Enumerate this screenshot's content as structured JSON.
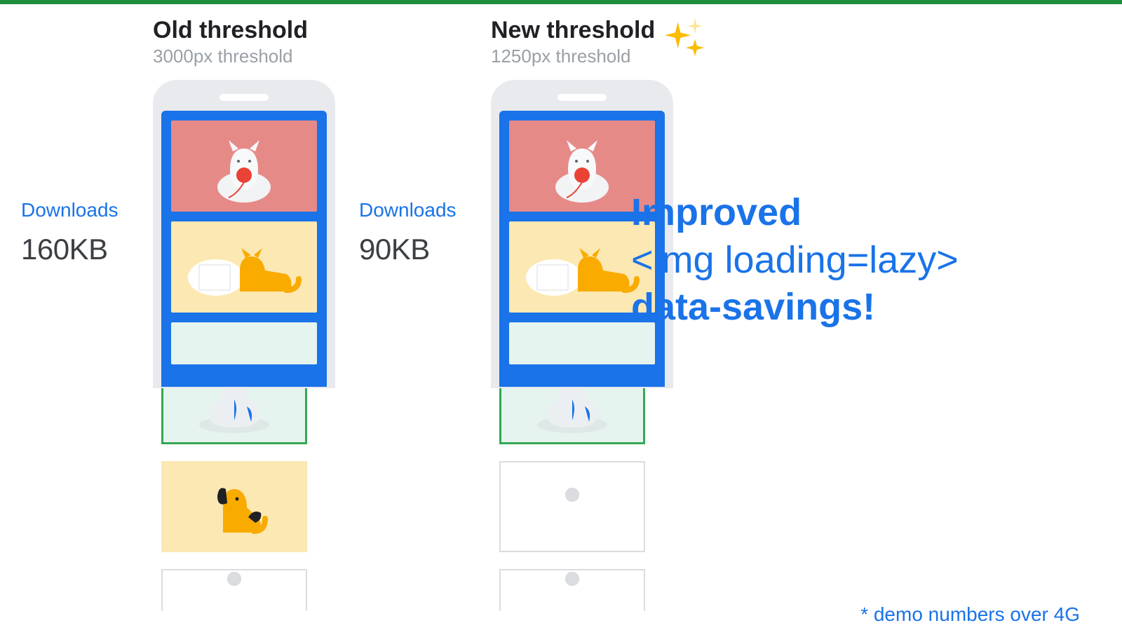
{
  "old": {
    "title": "Old threshold",
    "subtitle": "3000px threshold",
    "downloads_label": "Downloads",
    "downloads_value": "160KB"
  },
  "new": {
    "title": "New threshold",
    "subtitle": "1250px threshold",
    "downloads_label": "Downloads",
    "downloads_value": "90KB"
  },
  "hero": {
    "line1": "Improved",
    "line2": "<img loading=lazy>",
    "line3": "data-savings!"
  },
  "footnote": "* demo numbers over 4G"
}
